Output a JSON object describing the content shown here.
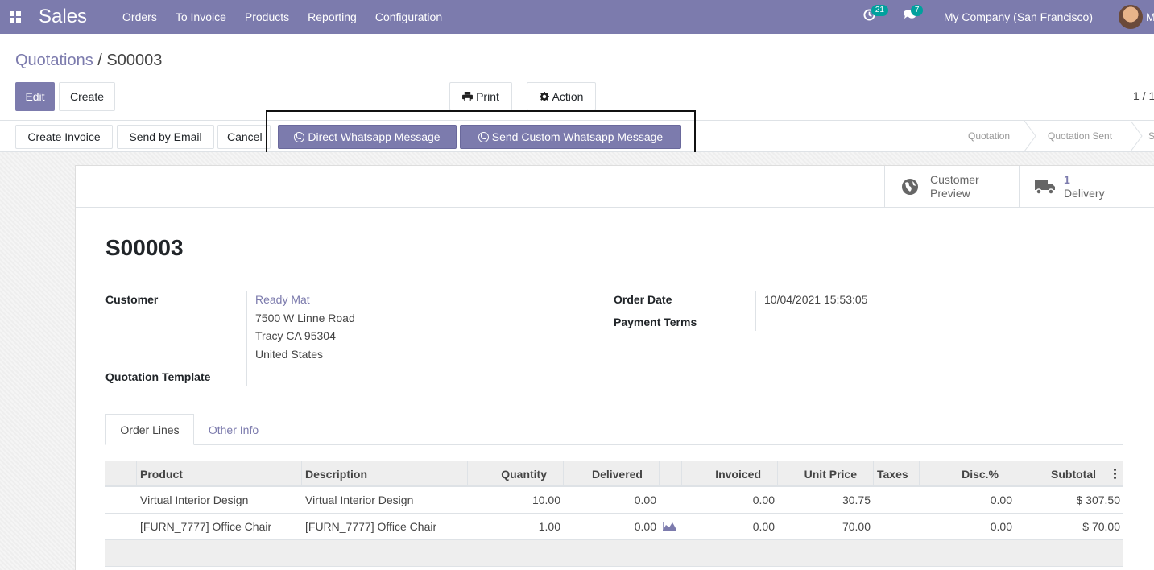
{
  "navbar": {
    "app_title": "Sales",
    "menu": [
      "Orders",
      "To Invoice",
      "Products",
      "Reporting",
      "Configuration"
    ],
    "activity_count": "21",
    "message_count": "7",
    "company": "My Company (San Francisco)",
    "user_initial": "M"
  },
  "breadcrumb": {
    "parent": "Quotations",
    "separator": " / ",
    "current": "S00003"
  },
  "control": {
    "edit": "Edit",
    "create": "Create",
    "print": "Print",
    "action": "Action",
    "pager": "1 / 1"
  },
  "statusbar": {
    "create_invoice": "Create Invoice",
    "send_email": "Send by Email",
    "cancel": "Cancel",
    "direct_whatsapp": "Direct Whatsapp Message",
    "custom_whatsapp": "Send Custom Whatsapp Message",
    "stages": [
      "Quotation",
      "Quotation Sent",
      "S"
    ]
  },
  "smart_buttons": {
    "customer_preview_line1": "Customer",
    "customer_preview_line2": "Preview",
    "delivery_count": "1",
    "delivery_label": "Delivery"
  },
  "record": {
    "name": "S00003",
    "customer_label": "Customer",
    "customer_name": "Ready Mat",
    "address_line1": "7500 W Linne Road",
    "address_line2": "Tracy CA 95304",
    "address_line3": "United States",
    "template_label": "Quotation Template",
    "order_date_label": "Order Date",
    "order_date": "10/04/2021 15:53:05",
    "payment_terms_label": "Payment Terms"
  },
  "tabs": {
    "order_lines": "Order Lines",
    "other_info": "Other Info"
  },
  "table": {
    "headers": {
      "product": "Product",
      "description": "Description",
      "quantity": "Quantity",
      "delivered": "Delivered",
      "invoiced": "Invoiced",
      "unit_price": "Unit Price",
      "taxes": "Taxes",
      "discount": "Disc.%",
      "subtotal": "Subtotal"
    },
    "rows": [
      {
        "product": "Virtual Interior Design",
        "description": "Virtual Interior Design",
        "quantity": "10.00",
        "delivered": "0.00",
        "invoiced": "0.00",
        "unit_price": "30.75",
        "taxes": "",
        "discount": "0.00",
        "subtotal": "$ 307.50"
      },
      {
        "product": "[FURN_7777] Office Chair",
        "description": "[FURN_7777] Office Chair",
        "quantity": "1.00",
        "delivered": "0.00",
        "invoiced": "0.00",
        "unit_price": "70.00",
        "taxes": "",
        "discount": "0.00",
        "subtotal": "$ 70.00"
      }
    ]
  },
  "colors": {
    "brand": "#7c7bad",
    "badge": "#00a09d"
  }
}
